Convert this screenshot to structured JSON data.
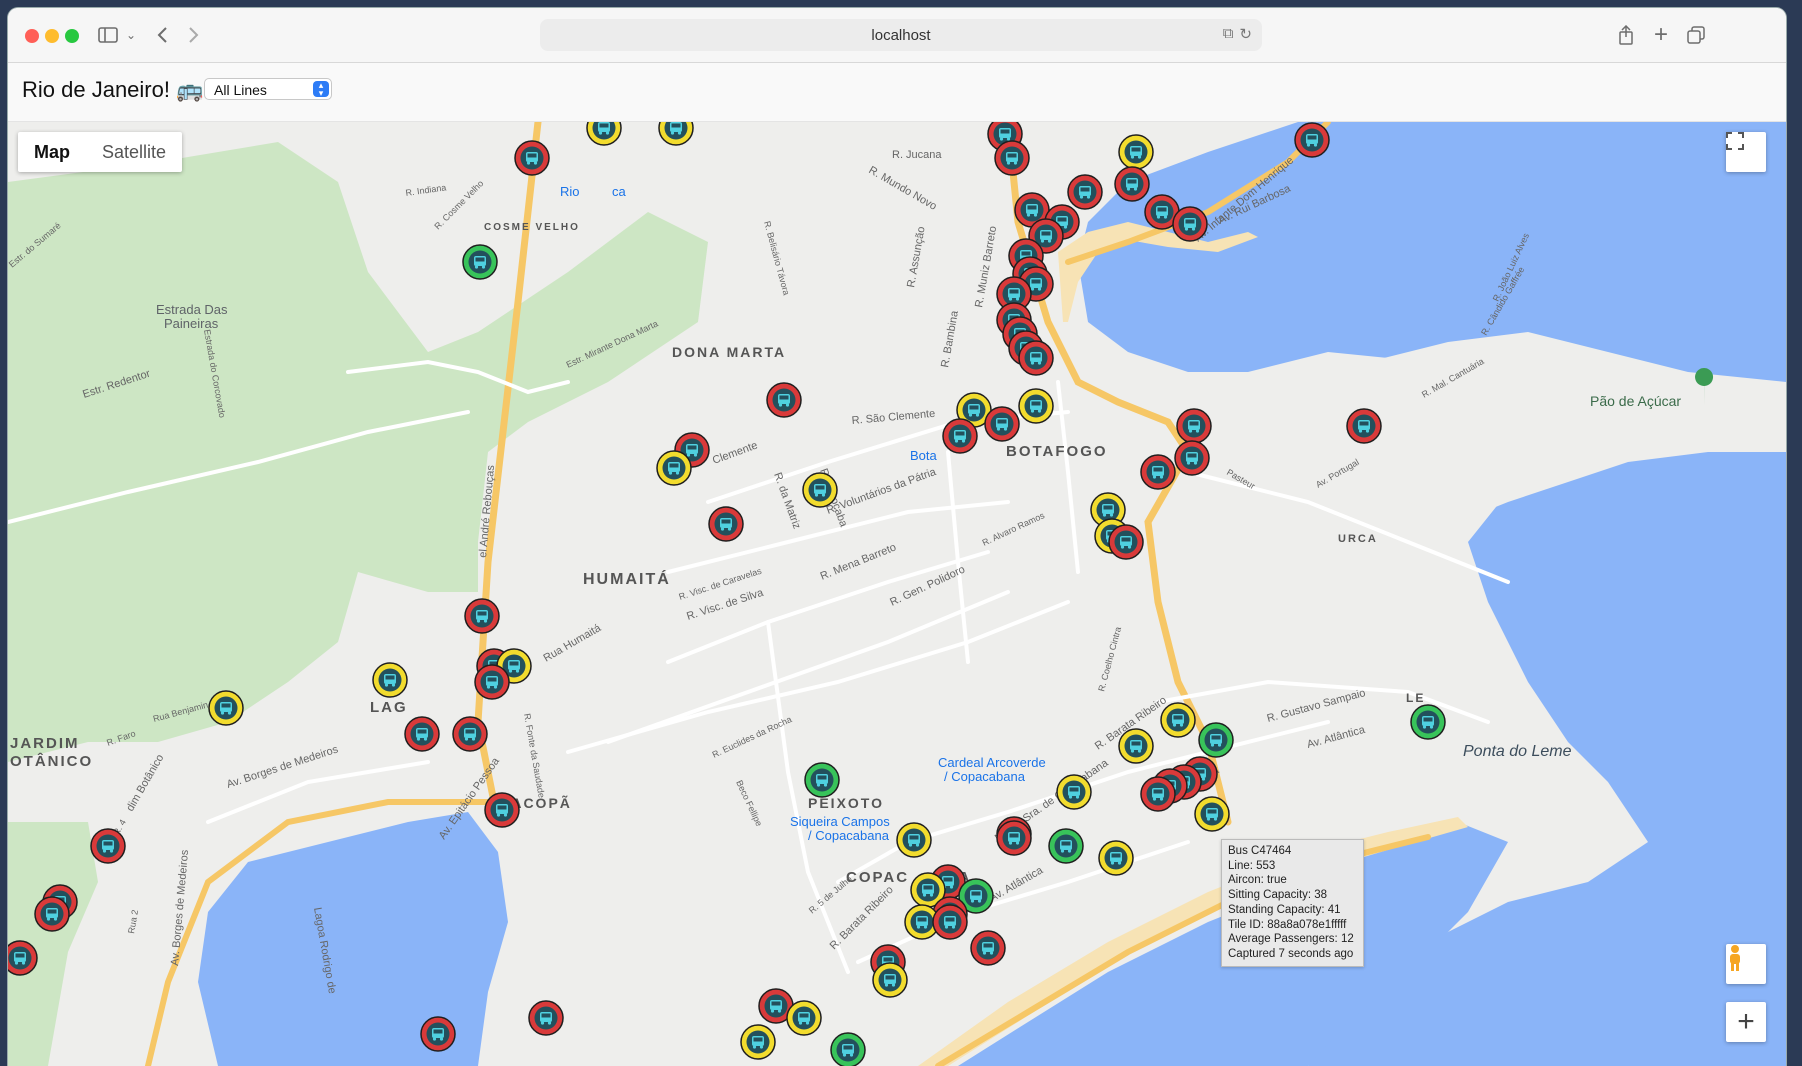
{
  "browser": {
    "url": "localhost",
    "traffic_colors": [
      "#ff5f57",
      "#febc2e",
      "#28c840"
    ]
  },
  "app": {
    "title": "Rio de Janeiro! 🚌",
    "line_filter": "All Lines"
  },
  "map_controls": {
    "map_label": "Map",
    "satellite_label": "Satellite",
    "zoom_in": "+"
  },
  "map_labels": {
    "neighborhoods": [
      "DONA MARTA",
      "BOTAFOGO",
      "HUMAITÁ",
      "URCA",
      "PEIXOTO",
      "SACOPÃ",
      "COSME VELHO",
      "JARDIM",
      "OTÂNICO",
      "LAG",
      "COPAC",
      "ANA",
      "LE"
    ],
    "places": [
      "Estrada Das",
      "Paineiras",
      "Pão de Açúcar",
      "Ponta do Leme",
      "Cardeal Arcoverde",
      "/ Copacabana",
      "Siqueira Campos",
      "/ Copacabana",
      "Bota",
      "Rio",
      "ca"
    ],
    "streets": [
      "R. São Clemente",
      "Clemente",
      "R. Voluntários da Pátria",
      "R. Mena Barreto",
      "R. Gen. Polidoro",
      "R. Visc. de Silva",
      "R. Visc. de Caravelas",
      "Rua Humaitá",
      "Av. Rui Barbosa",
      "Av. Infante Dom Henrique",
      "Av. Borges de Medeiros",
      "Av. Epitácio Pessoa",
      "Av. Atlântica",
      "Av. Atlântica",
      "R. Barata Ribeiro",
      "Nossa Sra. de Copacabana",
      "R. Gustavo Sampaio",
      "Av. Atlântica",
      "Estr. Redentor",
      "Estr. Mirante Dona Marta",
      "R. Jucana",
      "R. Mundo Novo",
      "R. Bambina",
      "R. Muniz Barreto",
      "R. Assunção",
      "R. Sorocaba",
      "R. da Matriz",
      "R. Alvaro Ramos",
      "R. Coelho Cintra",
      "R. Euclides da Rocha",
      "Beco Fellipe",
      "R. 5 de Julho",
      "R. Barata Ribeiro",
      "Pasteur",
      "Av. Portugal",
      "R. Mal. Cantuária",
      "R. Cândido Gaffrée",
      "R. João Luiz Alves",
      "Rua Benjamin",
      "R. Faro",
      "R. Fonte da Saudade",
      "Lagoa Rodrigo de",
      "R. Indiana",
      "R. Cosme Velho",
      "R. Belisário Távora",
      "Estr. do Sumaré",
      "Estrada do Corcovado",
      "el André Rebouças",
      "Av. Borges de Medeiros",
      "dim Botânico",
      "R. 4",
      "Rua 2"
    ]
  },
  "tooltip": {
    "lines": [
      "Bus C47464",
      "Line: 553",
      "Aircon: true",
      "Sitting Capacity: 38",
      "Standing Capacity: 41",
      "Tile ID: 88a8a078e1fffff",
      "Average Passengers: 12",
      "Captured 7 seconds ago"
    ]
  },
  "bus_status_colors": {
    "red": "#d93a3a",
    "yellow": "#f2dc2e",
    "green": "#38c35a",
    "inner": "#23505c",
    "bus_glyph": "#4fd1e0"
  },
  "colors": {
    "water": "#8ab4f8",
    "park": "#cde6c4",
    "road_major": "#f6c766",
    "beach": "#f7e3b5",
    "land": "#eeeeec"
  }
}
